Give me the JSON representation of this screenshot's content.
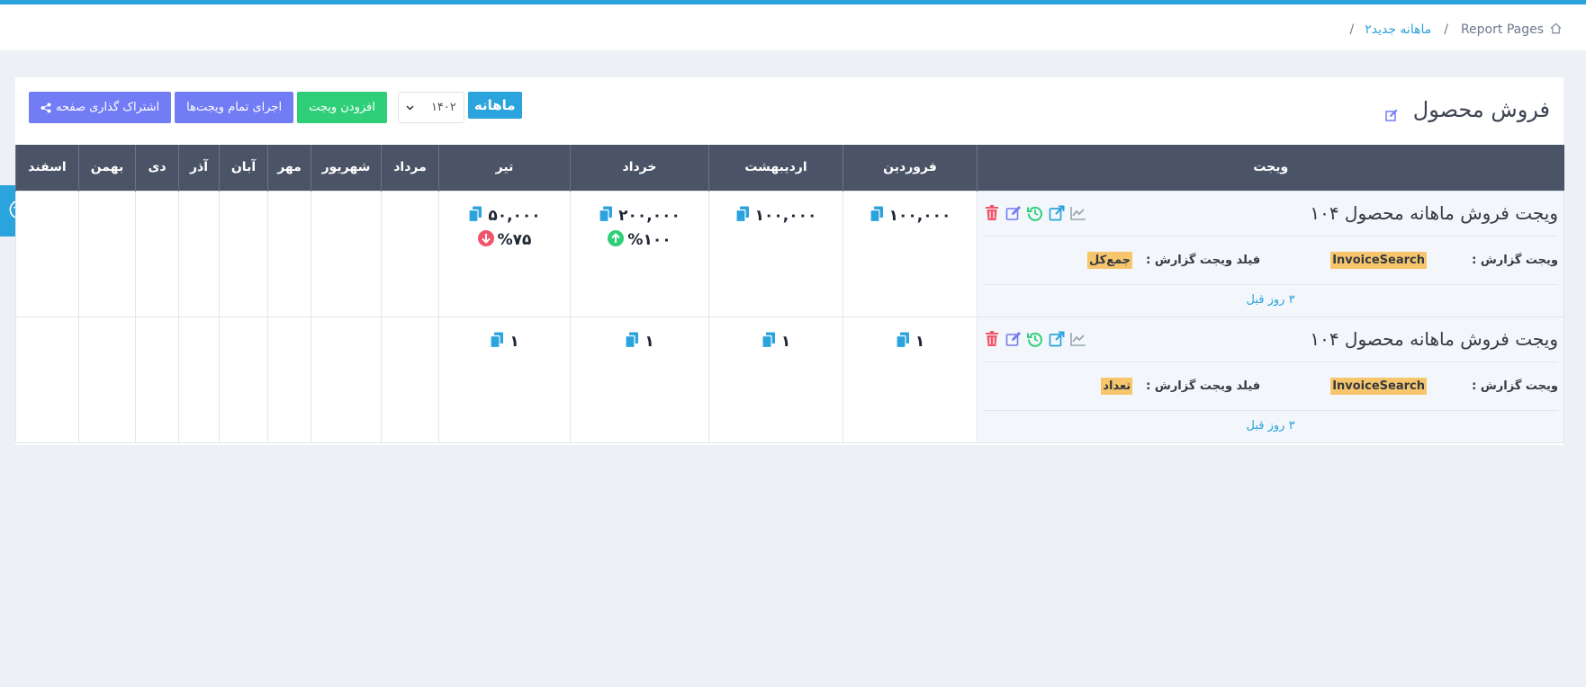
{
  "breadcrumb": {
    "root": "Report Pages",
    "separator": "/",
    "current": "ماهانه جدید۲",
    "trailing_separator": "/"
  },
  "page": {
    "title": "فروش محصول"
  },
  "controls": {
    "share_label": "اشتراک گذاری صفحه",
    "run_all_label": "اجرای تمام ویجت‌ها",
    "add_widget_label": "افزودن ویجت",
    "year_value": "۱۴۰۲",
    "period_badge": "ماهانه"
  },
  "table": {
    "headers": [
      "ویجت",
      "فروردین",
      "اردیبهشت",
      "خرداد",
      "تیر",
      "مرداد",
      "شهریور",
      "مهر",
      "آبان",
      "آذر",
      "دی",
      "بهمن",
      "اسفند"
    ],
    "rows": [
      {
        "title": "ویجت فروش ماهانه محصول ۱۰۴",
        "report_label": "ویجت گزارش :",
        "report_value": "InvoiceSearch",
        "field_label": "فیلد ویجت گزارش :",
        "field_value": "جمع‌کل",
        "time": "۳ روز قبل",
        "values": [
          "۱۰۰,۰۰۰",
          "۱۰۰,۰۰۰",
          "۲۰۰,۰۰۰",
          "۵۰,۰۰۰"
        ],
        "changes": [
          "",
          "",
          "%۱۰۰",
          "%۷۵"
        ]
      },
      {
        "title": "ویجت فروش ماهانه محصول ۱۰۴",
        "report_label": "ویجت گزارش :",
        "report_value": "InvoiceSearch",
        "field_label": "فیلد ویجت گزارش :",
        "field_value": "تعداد",
        "time": "۳ روز قبل",
        "values": [
          "۱",
          "۱",
          "۱",
          "۱"
        ],
        "changes": [
          "",
          "",
          "",
          ""
        ]
      }
    ]
  },
  "colors": {
    "accent": "#2ba3dc",
    "header_bg": "#4b5466",
    "success": "#2fcf79",
    "primary": "#727cf5",
    "danger": "#f1556c",
    "tag": "#f7c56b"
  }
}
